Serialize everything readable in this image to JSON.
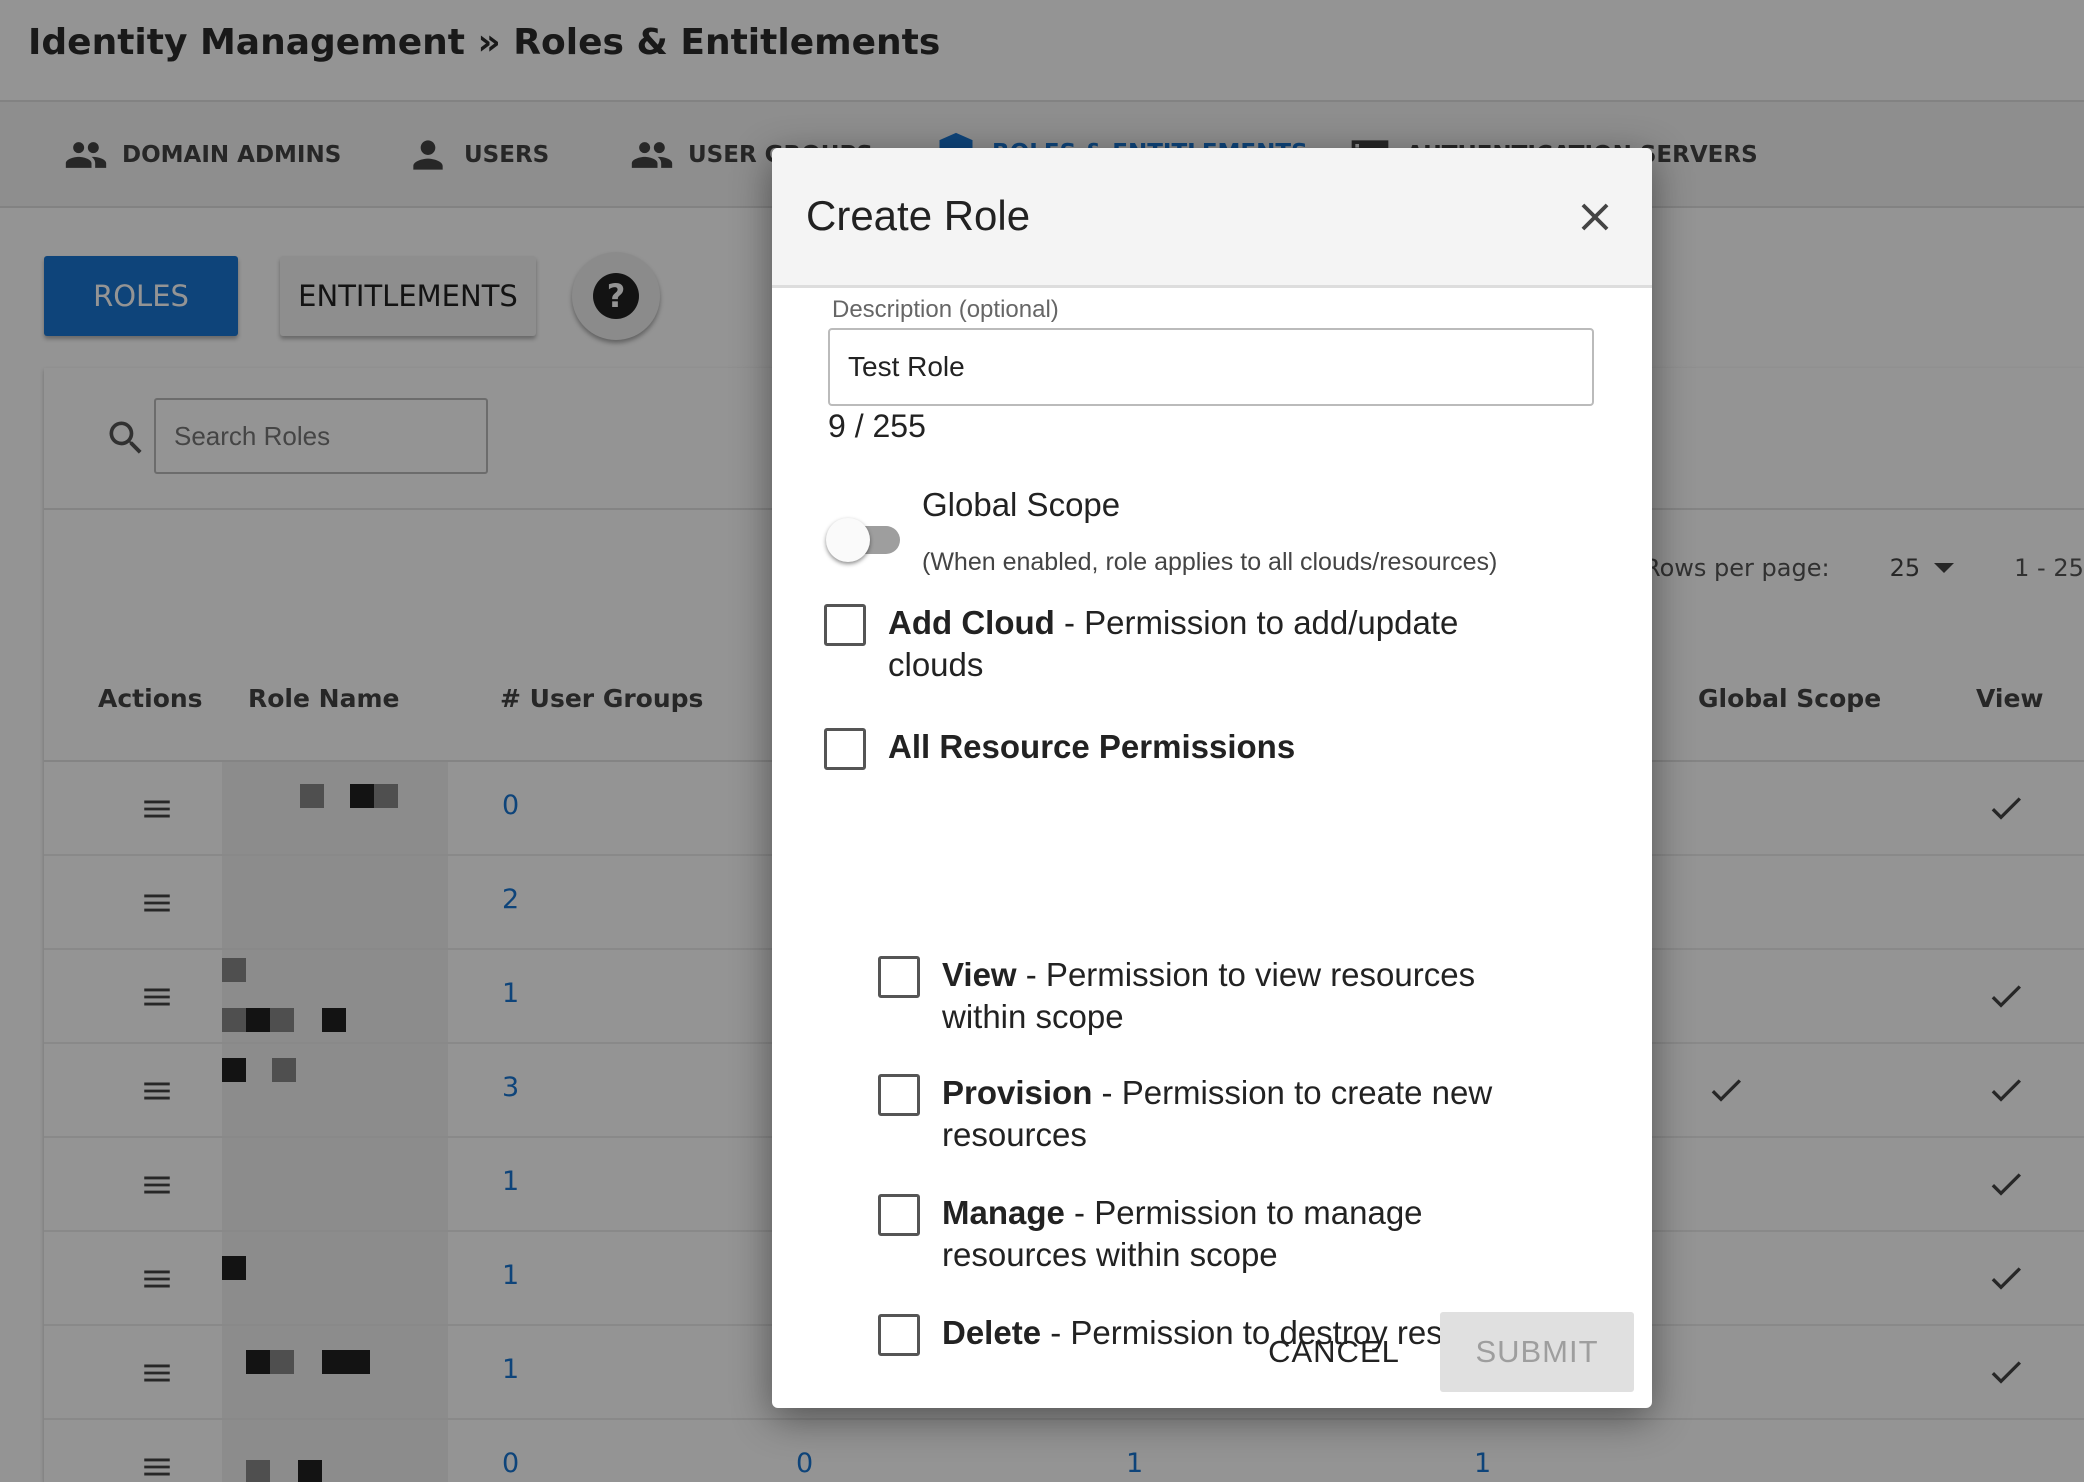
{
  "header": {
    "breadcrumb": "Identity Management » Roles & Entitlements"
  },
  "tabs": [
    {
      "label": "DOMAIN ADMINS",
      "icon": "group-icon"
    },
    {
      "label": "USERS",
      "icon": "person-icon"
    },
    {
      "label": "USER GROUPS",
      "icon": "group-icon"
    },
    {
      "label": "ROLES & ENTITLEMENTS",
      "icon": "shield-icon",
      "active": true
    },
    {
      "label": "AUTHENTICATION SERVERS",
      "icon": "server-icon"
    }
  ],
  "toolbar": {
    "roles_label": "ROLES",
    "entitlements_label": "ENTITLEMENTS",
    "help_label": "?"
  },
  "search": {
    "placeholder": "Search Roles"
  },
  "pagination": {
    "rows_per_page_label": "Rows per page:",
    "rows_per_page_value": "25",
    "range": "1 - 25"
  },
  "table": {
    "headers": {
      "actions": "Actions",
      "role_name": "Role Name",
      "user_groups": "# User Groups",
      "global_scope": "Global Scope",
      "view": "View"
    },
    "rows": [
      {
        "user_groups": "0",
        "global_scope": false,
        "view": true
      },
      {
        "user_groups": "2",
        "global_scope": false,
        "view": false
      },
      {
        "user_groups": "1",
        "global_scope": false,
        "view": true
      },
      {
        "user_groups": "3",
        "global_scope": true,
        "view": true
      },
      {
        "user_groups": "1",
        "global_scope": false,
        "view": true
      },
      {
        "user_groups": "1",
        "global_scope": false,
        "view": true
      },
      {
        "user_groups": "1",
        "global_scope": false,
        "view": true
      },
      {
        "user_groups": "0",
        "col3": "0",
        "col4": "1",
        "col5": "1"
      }
    ]
  },
  "dialog": {
    "title": "Create Role",
    "description_label": "Description (optional)",
    "description_value": "Test Role",
    "char_count": "9 / 255",
    "global_scope": {
      "title": "Global Scope",
      "subtitle": "(When enabled, role applies to all clouds/resources)",
      "enabled": false
    },
    "permissions": {
      "add_cloud": {
        "name": "Add Cloud",
        "desc": " - Permission to add/update clouds",
        "checked": false
      },
      "all_resource": {
        "name": "All Resource Permissions",
        "checked": false
      },
      "view": {
        "name": "View",
        "desc": " - Permission to view resources within scope",
        "checked": false
      },
      "provision": {
        "name": "Provision",
        "desc": " - Permission to create new resources",
        "checked": false
      },
      "manage": {
        "name": "Manage",
        "desc": " - Permission to manage resources within scope",
        "checked": false
      },
      "delete": {
        "name": "Delete",
        "desc": " - Permission to destroy resources",
        "checked": false
      }
    },
    "cancel_label": "CANCEL",
    "submit_label": "SUBMIT"
  },
  "colors": {
    "accent": "#1976d2",
    "overlay": "rgba(0,0,0,0.42)"
  }
}
